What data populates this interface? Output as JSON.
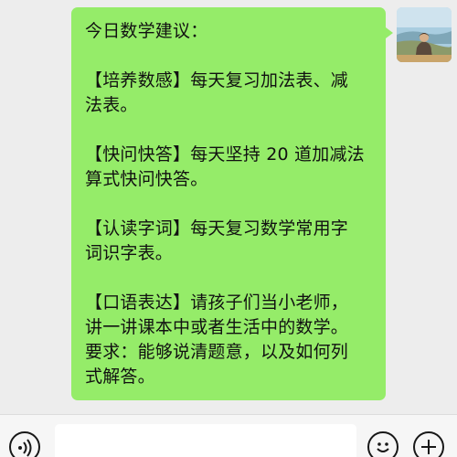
{
  "chat": {
    "message": {
      "lines": [
        "今日数学建议：",
        "",
        "【培养数感】每天复习加法表、减",
        "法表。",
        "",
        "【快问快答】每天坚持 20 道加减法",
        "算式快问快答。",
        "",
        "【认读字词】每天复习数学常用字",
        "词识字表。",
        "",
        "【口语表达】请孩子们当小老师，",
        "讲一讲课本中或者生活中的数学。",
        "要求：能够说清题意，以及如何列",
        "式解答。"
      ]
    }
  },
  "input_bar": {
    "voice_icon": "voice-icon",
    "emoji_icon": "emoji-icon",
    "plus_icon": "plus-icon"
  },
  "colors": {
    "bubble": "#95ec69",
    "background": "#ededed"
  }
}
